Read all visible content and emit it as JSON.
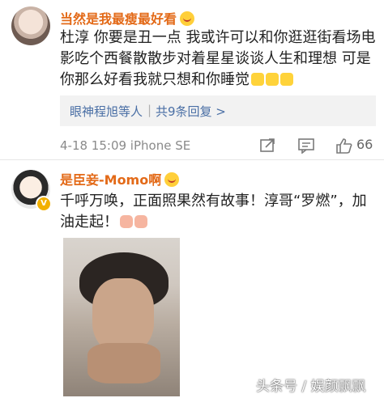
{
  "comment1": {
    "username": "当然是我最瘦最好看",
    "text": "杜淳  你要是丑一点 我或许可以和你逛逛街看场电影吃个西餐散散步对着星星谈谈人生和理想 可是你那么好看我就只想和你睡觉",
    "replies_names": "眼神程旭等人",
    "replies_separator": "|",
    "replies_count": "共9条回复 >",
    "timestamp": "4-18 15:09 iPhone SE",
    "likes": "66",
    "icons": [
      "share-icon",
      "comment-icon",
      "like-icon"
    ]
  },
  "comment2": {
    "username": "是臣妾-Momo啊",
    "text": "千呼万唤，正面照果然有故事！淳哥“罗燃”，加油走起！",
    "badge": "V"
  },
  "watermark": "头条号 / 娱颜飘飘",
  "colors": {
    "username": "#e36a18",
    "link": "#4a6fa5",
    "meta": "#8a8a8a"
  }
}
